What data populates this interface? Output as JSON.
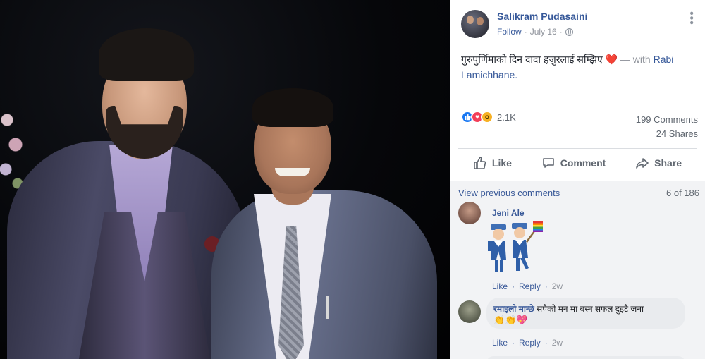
{
  "post": {
    "author": "Salikram Pudasaini",
    "follow_label": "Follow",
    "date": "July 16",
    "separator": "·",
    "more_icon": "more-dots-icon",
    "text": "गुरुपुर्णिमाको दिन दादा हजुरलाई सम्झिए",
    "emoji": "❤️",
    "with_label": "— with",
    "tagged": "Rabi Lamichhane."
  },
  "reactions": {
    "count": "2.1K",
    "icons": [
      "like-icon",
      "love-icon",
      "wow-icon"
    ]
  },
  "stats": {
    "comments": "199 Comments",
    "shares": "24 Shares"
  },
  "actions": {
    "like": "Like",
    "comment": "Comment",
    "share": "Share"
  },
  "comments": {
    "view_previous": "View previous comments",
    "count_of": "6 of 186",
    "items": [
      {
        "author": "Jeni Ale",
        "body": "",
        "like": "Like",
        "reply": "Reply",
        "time": "2w"
      },
      {
        "author": "रमाइलो मान्छे",
        "body": "सपैको मन मा बस्न सफल दुइटै जना",
        "emoji": "👏👏💖",
        "like": "Like",
        "reply": "Reply",
        "time": "2w"
      }
    ]
  },
  "colors": {
    "link": "#365899",
    "muted": "#90949c",
    "like_blue": "#1877f2",
    "love_red": "#f33e58",
    "wow_yellow": "#f7b125"
  }
}
